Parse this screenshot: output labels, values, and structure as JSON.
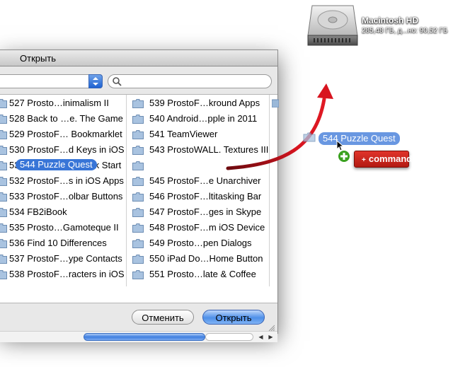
{
  "desktop": {
    "disk_name": "Macintosh HD",
    "disk_info": "285,48 ГБ, д...но: 90,52 ГБ"
  },
  "dialog": {
    "title": "Открыть",
    "buttons": {
      "cancel": "Отменить",
      "open": "Открыть"
    },
    "left_column": [
      "527 Prosto…inimalism II",
      "528 Back to …e. The Game",
      "529 ProstoF… Bookmarklet",
      "530 ProstoF…d Keys in iOS",
      "531 ProstoF…s Quick Start",
      "532 ProstoF…s in iOS Apps",
      "533 ProstoF…olbar Buttons",
      "534 FB2iBook",
      "535 Prosto…Gamoteque II",
      "536 Find 10 Differences",
      "537 ProstoF…ype Contacts",
      "538 ProstoF…racters in iOS"
    ],
    "right_column": [
      "539 ProstoF…kround Apps",
      "540 Android…pple in 2011",
      "541 TeamViewer",
      "543 ProstoWALL. Textures III",
      "544 Puzzle Quest",
      "545 ProstoF…e Unarchiver",
      "546 ProstoF…ltitasking Bar",
      "547 ProstoF…ges in Skype",
      "548 ProstoF…m iOS Device",
      "549 Prosto…pen Dialogs",
      "550 iPad Do…Home Button",
      "551 Prosto…late & Coffee"
    ],
    "selected_index": 4
  },
  "drag": {
    "label": "544 Puzzle Quest",
    "badge_label": "command",
    "badge_symbol": "+"
  },
  "colors": {
    "selection": "#3875d7",
    "badge_red": "#c8231b",
    "arrow_red": "#c4121f"
  }
}
